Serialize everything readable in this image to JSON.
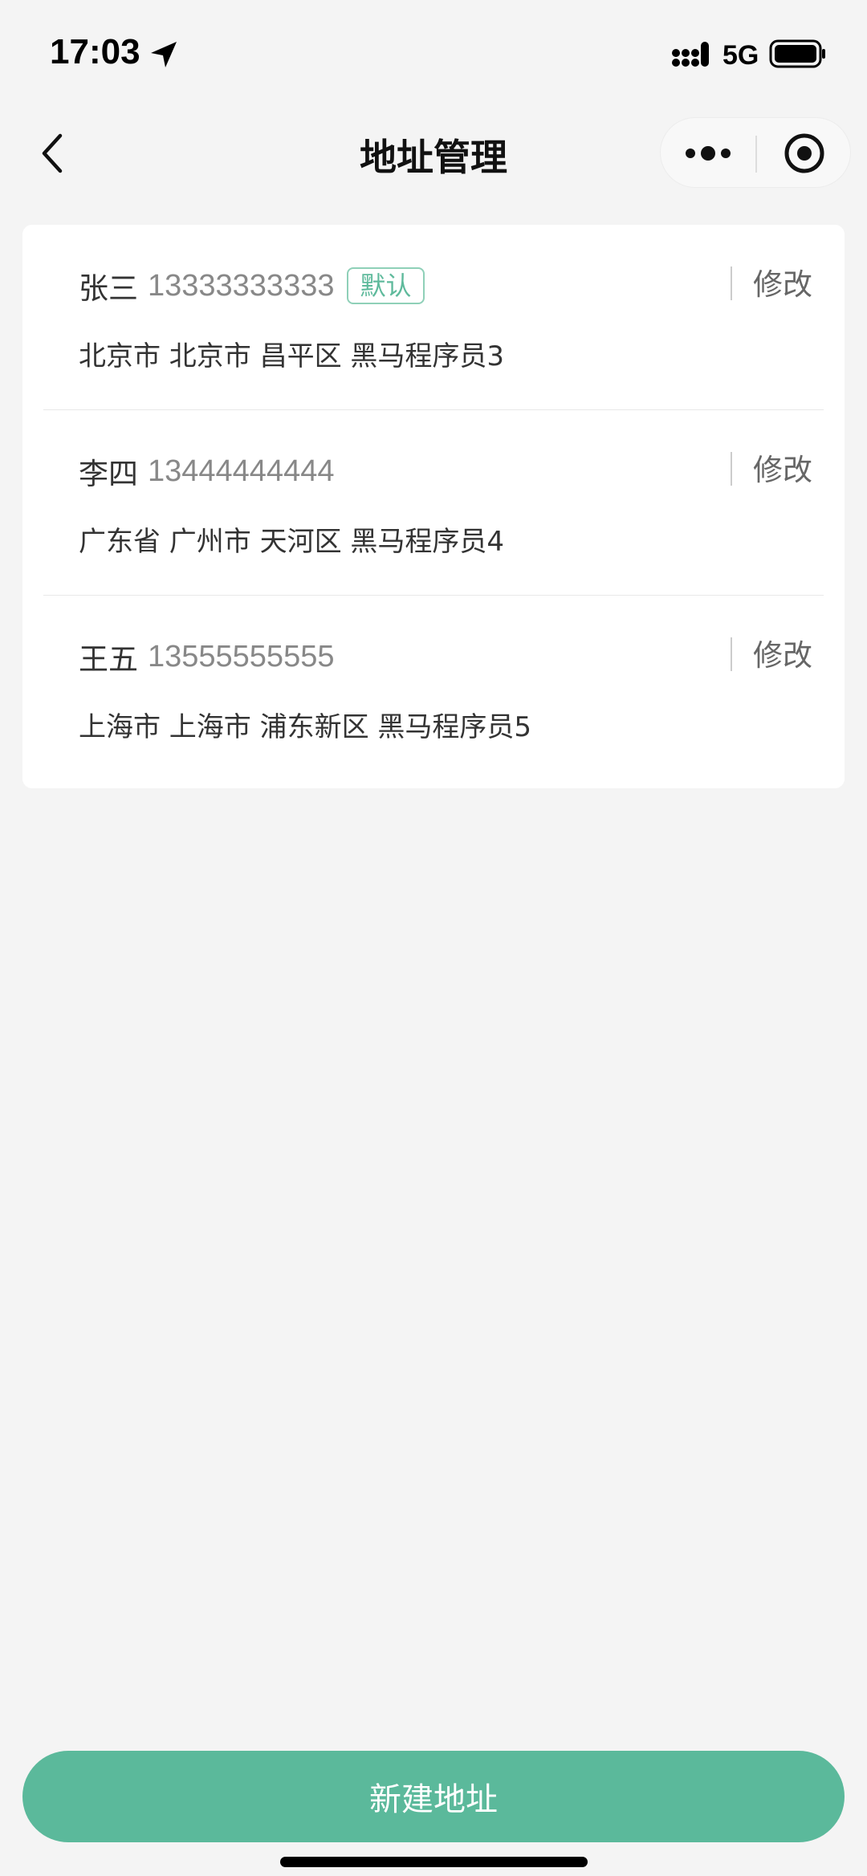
{
  "status_bar": {
    "time": "17:03",
    "network": "5G",
    "icons": [
      "location-arrow-icon",
      "signal-icon",
      "battery-icon"
    ]
  },
  "nav": {
    "title": "地址管理",
    "icons": [
      "back-chevron-icon",
      "more-dots-icon",
      "close-target-icon"
    ]
  },
  "addresses": [
    {
      "name": "张三",
      "phone": "13333333333",
      "badge": "默认",
      "address": "北京市 北京市 昌平区 黑马程序员3",
      "edit_label": "修改"
    },
    {
      "name": "李四",
      "phone": "13444444444",
      "address": "广东省 广州市 天河区 黑马程序员4",
      "edit_label": "修改"
    },
    {
      "name": "王五",
      "phone": "13555555555",
      "address": "上海市 上海市 浦东新区 黑马程序员5",
      "edit_label": "修改"
    }
  ],
  "footer": {
    "new_address_label": "新建地址"
  },
  "colors": {
    "accent": "#5bb99b",
    "background": "#f4f4f4",
    "card": "#ffffff"
  }
}
